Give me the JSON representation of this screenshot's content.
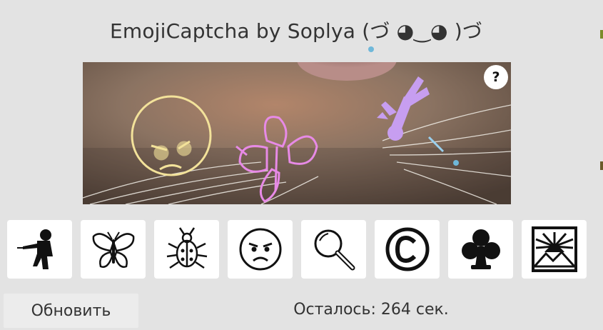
{
  "header": {
    "title": "EmojiCaptcha by Soplya (づ ◕‿◕ )づ"
  },
  "captcha": {
    "help_label": "?",
    "image_description_icons": [
      "angry-face",
      "butterfly",
      "falling-person"
    ]
  },
  "tiles": [
    {
      "icon": "fencer-icon"
    },
    {
      "icon": "butterfly-icon"
    },
    {
      "icon": "beetle-icon"
    },
    {
      "icon": "angry-face-icon"
    },
    {
      "icon": "magnifying-glass-icon"
    },
    {
      "icon": "copyright-icon"
    },
    {
      "icon": "club-suit-icon"
    },
    {
      "icon": "sunrise-mountains-icon"
    }
  ],
  "footer": {
    "refresh_label": "Обновить",
    "timer_text": "Осталось: 264 сек."
  },
  "colors": {
    "background": "#e3e3e3",
    "angry_outline": "#f3e29a",
    "butterfly_outline": "#e78ae6",
    "falling_person": "#c79ef0",
    "dot": "#6fb8d9"
  }
}
